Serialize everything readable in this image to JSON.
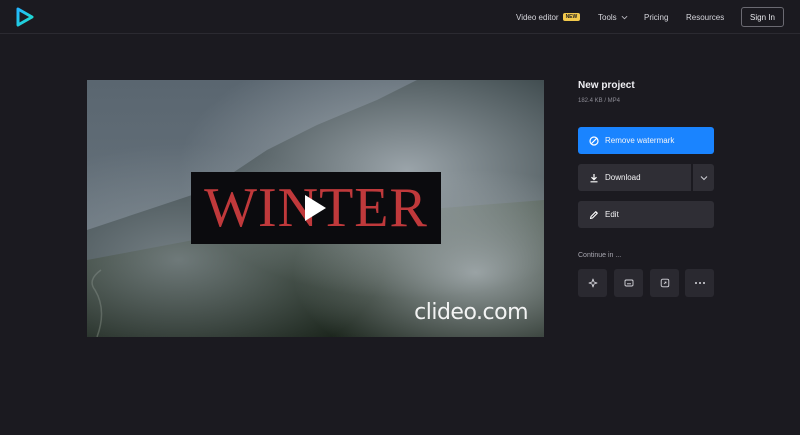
{
  "nav": {
    "video_editor": "Video editor",
    "video_editor_badge": "NEW",
    "tools": "Tools",
    "pricing": "Pricing",
    "resources": "Resources",
    "sign_in": "Sign In"
  },
  "video": {
    "title_text": "WINTER",
    "watermark": "clideo.com"
  },
  "project": {
    "title": "New project",
    "meta": "182.4 KB  /  MP4"
  },
  "actions": {
    "remove_watermark": "Remove watermark",
    "download": "Download",
    "edit": "Edit"
  },
  "continue": {
    "label": "Continue in ..."
  },
  "colors": {
    "background": "#1b1a20",
    "accent": "#1a84ff",
    "badge": "#f2c94c",
    "title_red": "#c0393b"
  }
}
